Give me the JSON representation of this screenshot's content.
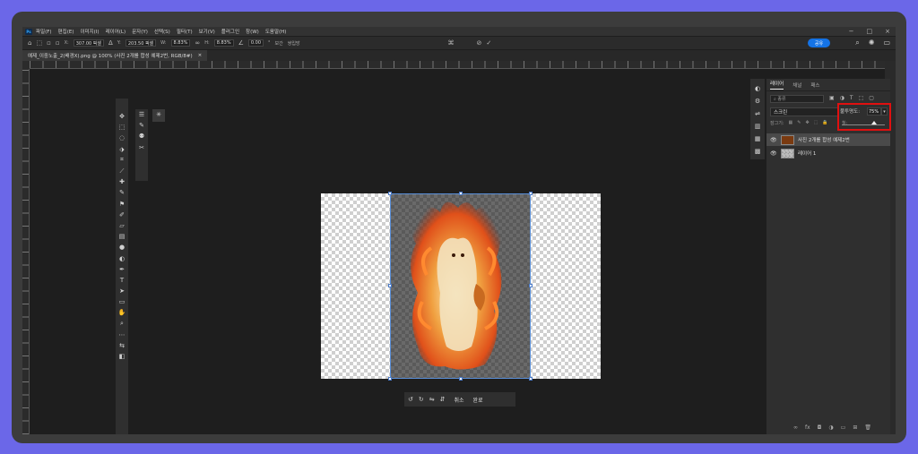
{
  "menu": {
    "items": [
      "파일(F)",
      "편집(E)",
      "이미지(I)",
      "레이어(L)",
      "문자(Y)",
      "선택(S)",
      "필터(T)",
      "보기(V)",
      "플러그인",
      "창(W)",
      "도움말(H)"
    ]
  },
  "options": {
    "x_label": "X:",
    "x_value": "307.00 픽셀",
    "y_label": "Y:",
    "y_value": "203.50 픽셀",
    "w_label": "W:",
    "w_value": "8.83%",
    "h_label": "H:",
    "h_value": "8.83%",
    "angle_value": "0.00",
    "degree_symbol": "°",
    "interp_label": "보간",
    "interp_value": "쌍입방",
    "share_label": "공유"
  },
  "document": {
    "tab_title": "예제_이중노출_2(배경X).png @ 100% (사진 2개를 합성 예제2번, RGB/8#)",
    "close_glyph": "×"
  },
  "transform": {
    "cancel_label": "취소",
    "confirm_label": "완료"
  },
  "layers_panel": {
    "tabs": [
      "레이어",
      "채널",
      "패스"
    ],
    "search_placeholder": "종류",
    "blend_mode": "스크린",
    "opacity_label": "불투명도:",
    "opacity_value": "75%",
    "opacity_fraction": 0.75,
    "lock_label": "잠그기:",
    "fill_label": "칠:",
    "layers": [
      {
        "name": "사진 2개를 합성 예제2번",
        "selected": true,
        "visible": true
      },
      {
        "name": "레이어 1",
        "selected": false,
        "visible": true
      }
    ]
  },
  "colors": {
    "accent": "#1473e6",
    "highlight_box": "#e01010",
    "background_frame": "#6b67e8"
  }
}
